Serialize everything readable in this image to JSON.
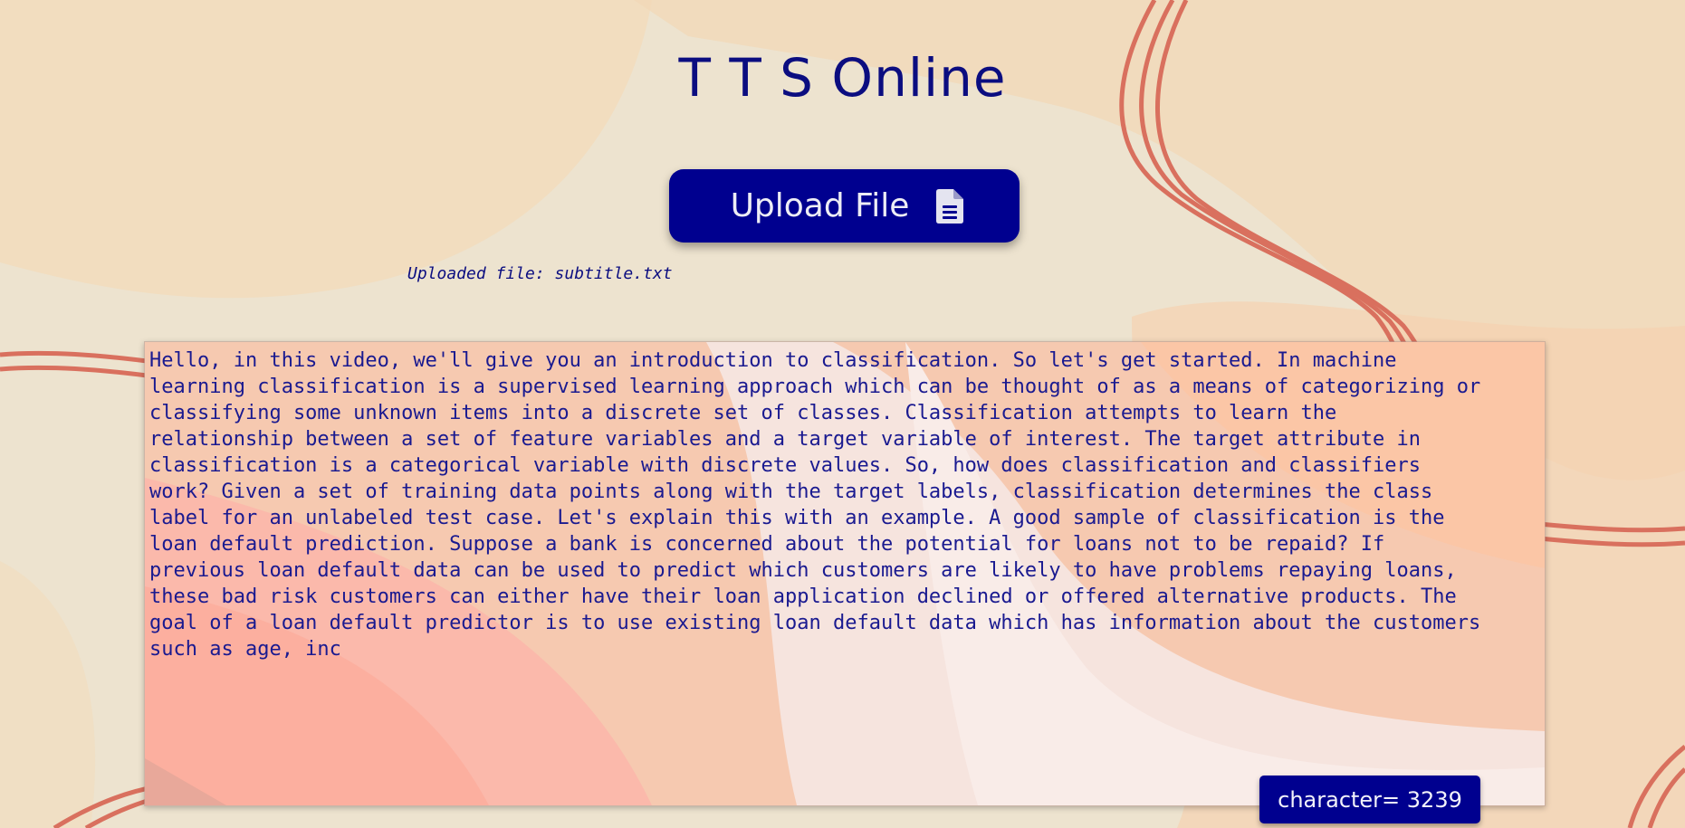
{
  "page": {
    "title": "T T S Online"
  },
  "upload": {
    "button_label": "Upload File",
    "icon": "file-text-icon",
    "uploaded_text": "Uploaded file: subtitle.txt"
  },
  "editor": {
    "text": "Hello, in this video, we'll give you an introduction to classification. So let's get started. In machine\nlearning classification is a supervised learning approach which can be thought of as a means of categorizing or\nclassifying some unknown items into a discrete set of classes. Classification attempts to learn the\nrelationship between a set of feature variables and a target variable of interest. The target attribute in\nclassification is a categorical variable with discrete values. So, how does classification and classifiers\nwork? Given a set of training data points along with the target labels, classification determines the class\nlabel for an unlabeled test case. Let's explain this with an example. A good sample of classification is the\nloan default prediction. Suppose a bank is concerned about the potential for loans not to be repaid? If\nprevious loan default data can be used to predict which customers are likely to have problems repaying loans,\nthese bad risk customers can either have their loan application declined or offered alternative products. The\ngoal of a loan default predictor is to use existing loan default data which has information about the customers\nsuch as age, inc"
  },
  "counter": {
    "label": "character= 3239"
  },
  "colors": {
    "primary": "#00008f",
    "title": "#0b0d80",
    "text": "#1a1a90",
    "background": "#ede3cf",
    "accent_stroke": "#d9705e"
  }
}
